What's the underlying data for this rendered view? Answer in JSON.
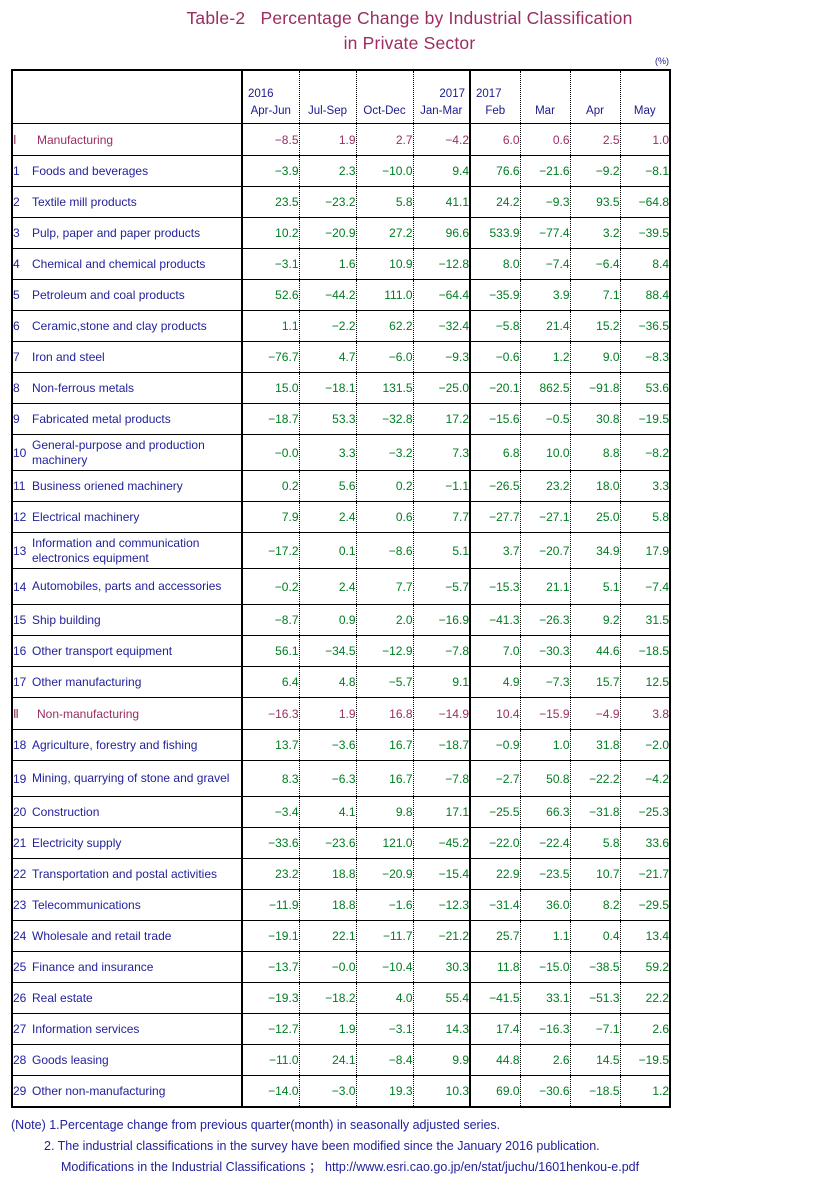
{
  "title": {
    "line1": "Table-2   Percentage Change by Industrial Classification",
    "line2": "in Private Sector"
  },
  "unit_label": "(%)",
  "table": {
    "header": {
      "blank_label": "",
      "columns": [
        {
          "year": "2016",
          "year_align": "left",
          "period": "Apr-Jun",
          "group": "quarterly"
        },
        {
          "year": "",
          "year_align": "left",
          "period": "Jul-Sep",
          "group": "quarterly"
        },
        {
          "year": "",
          "year_align": "left",
          "period": "Oct-Dec",
          "group": "quarterly"
        },
        {
          "year": "2017",
          "year_align": "right",
          "period": "Jan-Mar",
          "group": "quarterly"
        },
        {
          "year": "2017",
          "year_align": "left",
          "period": "Feb",
          "group": "monthly"
        },
        {
          "year": "",
          "year_align": "left",
          "period": "Mar",
          "group": "monthly"
        },
        {
          "year": "",
          "year_align": "left",
          "period": "Apr",
          "group": "monthly"
        },
        {
          "year": "",
          "year_align": "left",
          "period": "May",
          "group": "monthly"
        }
      ]
    },
    "rows": [
      {
        "type": "group",
        "num": "Ⅰ",
        "label": "Manufacturing",
        "values": [
          "-8.5",
          "1.9",
          "2.7",
          "-4.2",
          "6.0",
          "0.6",
          "2.5",
          "1.0"
        ]
      },
      {
        "type": "item",
        "num": "1",
        "label": "Foods and beverages",
        "values": [
          "-3.9",
          "2.3",
          "-10.0",
          "9.4",
          "76.6",
          "-21.6",
          "-9.2",
          "-8.1"
        ]
      },
      {
        "type": "item",
        "num": "2",
        "label": "Textile mill products",
        "values": [
          "23.5",
          "-23.2",
          "5.8",
          "41.1",
          "24.2",
          "-9.3",
          "93.5",
          "-64.8"
        ]
      },
      {
        "type": "item",
        "num": "3",
        "label": "Pulp, paper and paper products",
        "values": [
          "10.2",
          "-20.9",
          "27.2",
          "96.6",
          "533.9",
          "-77.4",
          "3.2",
          "-39.5"
        ]
      },
      {
        "type": "item",
        "num": "4",
        "label": "Chemical and chemical products",
        "values": [
          "-3.1",
          "1.6",
          "10.9",
          "-12.8",
          "8.0",
          "-7.4",
          "-6.4",
          "8.4"
        ]
      },
      {
        "type": "item",
        "num": "5",
        "label": "Petroleum and coal products",
        "values": [
          "52.6",
          "-44.2",
          "111.0",
          "-64.4",
          "-35.9",
          "3.9",
          "7.1",
          "88.4"
        ]
      },
      {
        "type": "item",
        "num": "6",
        "label": "Ceramic,stone and clay products",
        "values": [
          "1.1",
          "-2.2",
          "62.2",
          "-32.4",
          "-5.8",
          "21.4",
          "15.2",
          "-36.5"
        ]
      },
      {
        "type": "item",
        "num": "7",
        "label": "Iron and steel",
        "values": [
          "-76.7",
          "4.7",
          "-6.0",
          "-9.3",
          "-0.6",
          "1.2",
          "9.0",
          "-8.3"
        ]
      },
      {
        "type": "item",
        "num": "8",
        "label": "Non-ferrous metals",
        "values": [
          "15.0",
          "-18.1",
          "131.5",
          "-25.0",
          "-20.1",
          "862.5",
          "-91.8",
          "53.6"
        ]
      },
      {
        "type": "item",
        "num": "9",
        "label": "Fabricated metal products",
        "values": [
          "-18.7",
          "53.3",
          "-32.8",
          "17.2",
          "-15.6",
          "-0.5",
          "30.8",
          "-19.5"
        ]
      },
      {
        "type": "item",
        "num": "10",
        "label": "General-purpose and production machinery",
        "two_line": true,
        "values": [
          "-0.0",
          "3.3",
          "-3.2",
          "7.3",
          "6.8",
          "10.0",
          "8.8",
          "-8.2"
        ]
      },
      {
        "type": "item",
        "num": "11",
        "label": "Business oriened machinery",
        "values": [
          "0.2",
          "5.6",
          "0.2",
          "-1.1",
          "-26.5",
          "23.2",
          "18.0",
          "3.3"
        ]
      },
      {
        "type": "item",
        "num": "12",
        "label": "Electrical machinery",
        "values": [
          "7.9",
          "2.4",
          "0.6",
          "7.7",
          "-27.7",
          "-27.1",
          "25.0",
          "5.8"
        ]
      },
      {
        "type": "item",
        "num": "13",
        "label": "Information and communication electronics equipment",
        "two_line": true,
        "values": [
          "-17.2",
          "0.1",
          "-8.6",
          "5.1",
          "3.7",
          "-20.7",
          "34.9",
          "17.9"
        ]
      },
      {
        "type": "item",
        "num": "14",
        "label": "Automobiles, parts and accessories",
        "two_line": true,
        "values": [
          "-0.2",
          "2.4",
          "7.7",
          "-5.7",
          "-15.3",
          "21.1",
          "5.1",
          "-7.4"
        ]
      },
      {
        "type": "item",
        "num": "15",
        "label": "Ship building",
        "values": [
          "-8.7",
          "0.9",
          "2.0",
          "-16.9",
          "-41.3",
          "-26.3",
          "9.2",
          "31.5"
        ]
      },
      {
        "type": "item",
        "num": "16",
        "label": "Other transport equipment",
        "values": [
          "56.1",
          "-34.5",
          "-12.9",
          "-7.8",
          "7.0",
          "-30.3",
          "44.6",
          "-18.5"
        ]
      },
      {
        "type": "item",
        "num": "17",
        "label": "Other manufacturing",
        "values": [
          "6.4",
          "4.8",
          "-5.7",
          "9.1",
          "4.9",
          "-7.3",
          "15.7",
          "12.5"
        ]
      },
      {
        "type": "group",
        "num": "Ⅱ",
        "label": "Non-manufacturing",
        "values": [
          "-16.3",
          "1.9",
          "16.8",
          "-14.9",
          "10.4",
          "-15.9",
          "-4.9",
          "3.8"
        ]
      },
      {
        "type": "item",
        "num": "18",
        "label": "Agriculture, forestry and fishing",
        "values": [
          "13.7",
          "-3.6",
          "16.7",
          "-18.7",
          "-0.9",
          "1.0",
          "31.8",
          "-2.0"
        ]
      },
      {
        "type": "item",
        "num": "19",
        "label": "Mining, quarrying of stone and gravel",
        "two_line": true,
        "values": [
          "8.3",
          "-6.3",
          "16.7",
          "-7.8",
          "-2.7",
          "50.8",
          "-22.2",
          "-4.2"
        ]
      },
      {
        "type": "item",
        "num": "20",
        "label": "Construction",
        "values": [
          "-3.4",
          "4.1",
          "9.8",
          "17.1",
          "-25.5",
          "66.3",
          "-31.8",
          "-25.3"
        ]
      },
      {
        "type": "item",
        "num": "21",
        "label": "Electricity supply",
        "values": [
          "-33.6",
          "-23.6",
          "121.0",
          "-45.2",
          "-22.0",
          "-22.4",
          "5.8",
          "33.6"
        ]
      },
      {
        "type": "item",
        "num": "22",
        "label": "Transportation and postal activities",
        "values": [
          "23.2",
          "18.8",
          "-20.9",
          "-15.4",
          "22.9",
          "-23.5",
          "10.7",
          "-21.7"
        ]
      },
      {
        "type": "item",
        "num": "23",
        "label": "Telecommunications",
        "values": [
          "-11.9",
          "18.8",
          "-1.6",
          "-12.3",
          "-31.4",
          "36.0",
          "8.2",
          "-29.5"
        ]
      },
      {
        "type": "item",
        "num": "24",
        "label": "Wholesale and retail trade",
        "values": [
          "-19.1",
          "22.1",
          "-11.7",
          "-21.2",
          "25.7",
          "1.1",
          "0.4",
          "13.4"
        ]
      },
      {
        "type": "item",
        "num": "25",
        "label": "Finance and insurance",
        "values": [
          "-13.7",
          "-0.0",
          "-10.4",
          "30.3",
          "11.8",
          "-15.0",
          "-38.5",
          "59.2"
        ]
      },
      {
        "type": "item",
        "num": "26",
        "label": "Real estate",
        "values": [
          "-19.3",
          "-18.2",
          "4.0",
          "55.4",
          "-41.5",
          "33.1",
          "-51.3",
          "22.2"
        ]
      },
      {
        "type": "item",
        "num": "27",
        "label": "Information services",
        "values": [
          "-12.7",
          "1.9",
          "-3.1",
          "14.3",
          "17.4",
          "-16.3",
          "-7.1",
          "2.6"
        ]
      },
      {
        "type": "item",
        "num": "28",
        "label": "Goods leasing",
        "values": [
          "-11.0",
          "24.1",
          "-8.4",
          "9.9",
          "44.8",
          "2.6",
          "14.5",
          "-19.5"
        ]
      },
      {
        "type": "item",
        "num": "29",
        "label": "Other non-manufacturing",
        "values": [
          "-14.0",
          "-3.0",
          "19.3",
          "10.3",
          "69.0",
          "-30.6",
          "-18.5",
          "1.2"
        ]
      }
    ]
  },
  "notes": {
    "note1": "(Note) 1.Percentage change from previous quarter(month) in seasonally adjusted series.",
    "note2": "2. The industrial classifications in the survey have been modified since  the January 2016 publication.",
    "note3": "Modifications in the Industrial Classifications ；  http://www.esri.cao.go.jp/en/stat/juchu/1601henkou-e.pdf"
  },
  "colors": {
    "title": "#9B2D63",
    "label_text": "#22229C",
    "value_text": "#007C21",
    "group_text": "#9B2D63"
  }
}
